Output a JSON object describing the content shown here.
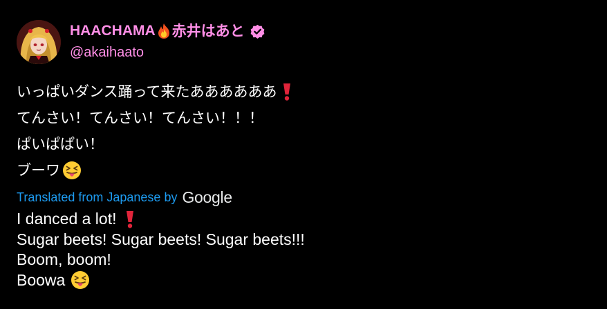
{
  "tweet": {
    "author": {
      "display_name": "HAACHAMA",
      "display_name_jp": "赤井はあと",
      "handle": "@akaihaato",
      "name_color": "#ff8ee6",
      "fire_icon": "fire-icon",
      "verified_icon": "verified-badge-icon"
    },
    "original_lines": [
      "いっぱいダンス踊って来たああああああ",
      "てんさい！てんさい！てんさい！！！",
      "ぱいぱぱい！",
      "ブーワ"
    ],
    "translation": {
      "label": "Translated from Japanese by",
      "provider": "Google",
      "label_color": "#1d9bf0"
    },
    "translated_lines": [
      "I danced a lot!",
      "Sugar beets! Sugar beets! Sugar beets!!!",
      "Boom, boom!",
      "Boowa"
    ],
    "emojis": {
      "exclamation": "heavy-exclamation-icon",
      "grin": "squinting-tongue-face-icon"
    }
  }
}
